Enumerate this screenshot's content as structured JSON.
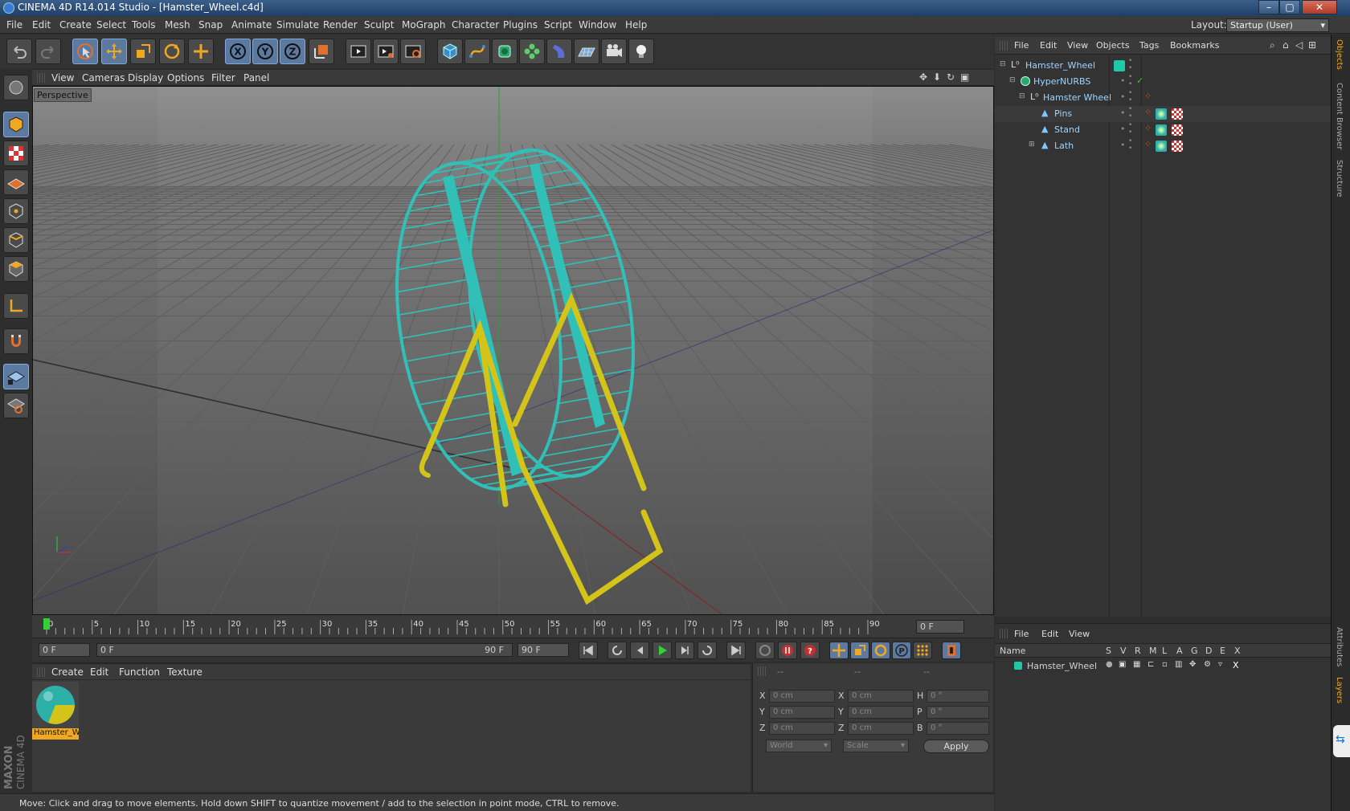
{
  "window": {
    "title": "CINEMA 4D R14.014 Studio - [Hamster_Wheel.c4d]",
    "min": "–",
    "max": "▢",
    "close": "✕"
  },
  "menubar": {
    "items": [
      "File",
      "Edit",
      "Create",
      "Select",
      "Tools",
      "Mesh",
      "Snap",
      "Animate",
      "Simulate",
      "Render",
      "Sculpt",
      "MoGraph",
      "Character",
      "Plugins",
      "Script",
      "Window",
      "Help"
    ],
    "layout_label": "Layout:",
    "layout_value": "Startup (User)"
  },
  "toolbar": {
    "icons": [
      "undo-icon",
      "redo-icon",
      "live-select-icon",
      "move-icon",
      "scale-icon",
      "rotate-icon",
      "add-icon",
      "x-axis-icon",
      "y-axis-icon",
      "z-axis-icon",
      "coordinate-system-icon",
      "render-view-icon",
      "render-picture-viewer-icon",
      "edit-render-settings-icon",
      "cube-icon",
      "spline-icon",
      "nurbs-icon",
      "mograph-cloner-icon",
      "deformer-icon",
      "scene-floor-icon",
      "camera-icon",
      "light-icon"
    ],
    "axes": [
      "X",
      "Y",
      "Z"
    ]
  },
  "viewport": {
    "menu": [
      "View",
      "Cameras",
      "Display",
      "Options",
      "Filter",
      "Panel"
    ],
    "label": "Perspective",
    "colors": {
      "wheel": "#30c0b8",
      "stand": "#d4c41a",
      "bg_top": "#8a8a8a",
      "bg_bottom": "#4b4b4b"
    }
  },
  "timeline": {
    "ticks": [
      "0",
      "5",
      "10",
      "15",
      "20",
      "25",
      "30",
      "35",
      "40",
      "45",
      "50",
      "55",
      "60",
      "65",
      "70",
      "75",
      "80",
      "85",
      "90"
    ],
    "current_frame": "0 F",
    "start_frame": "0 F",
    "slider_left": "0 F",
    "slider_right": "90 F",
    "end_frame": "90 F",
    "playhead_frame": 0
  },
  "material_panel": {
    "menu": [
      "Create",
      "Edit",
      "Function",
      "Texture"
    ],
    "material_name": "Hamster_W"
  },
  "coordinates": {
    "headers": [
      "--",
      "--",
      "--"
    ],
    "rows": [
      {
        "axis": "X",
        "pos": "0 cm",
        "axis2": "X",
        "size": "0 cm",
        "rot_label": "H",
        "rot": "0 °"
      },
      {
        "axis": "Y",
        "pos": "0 cm",
        "axis2": "Y",
        "size": "0 cm",
        "rot_label": "P",
        "rot": "0 °"
      },
      {
        "axis": "Z",
        "pos": "0 cm",
        "axis2": "Z",
        "size": "0 cm",
        "rot_label": "B",
        "rot": "0 °"
      }
    ],
    "mode1": "World",
    "mode2": "Scale",
    "apply": "Apply"
  },
  "status": "Move: Click and drag to move elements. Hold down SHIFT to quantize movement / add to the selection in point mode, CTRL to remove.",
  "objects": {
    "menu": [
      "File",
      "Edit",
      "View",
      "Objects",
      "Tags",
      "Bookmarks"
    ],
    "items": [
      {
        "name": "Hamster_Wheel",
        "indent": 0,
        "icon": "null-icon"
      },
      {
        "name": "HyperNURBS",
        "indent": 1,
        "icon": "hypernurbs-icon"
      },
      {
        "name": "Hamster Wheel",
        "indent": 2,
        "icon": "null-icon"
      },
      {
        "name": "Pins",
        "indent": 3,
        "icon": "polygon-icon"
      },
      {
        "name": "Stand",
        "indent": 3,
        "icon": "polygon-icon"
      },
      {
        "name": "Lath",
        "indent": 3,
        "icon": "polygon-icon"
      }
    ]
  },
  "layers": {
    "menu": [
      "File",
      "Edit",
      "View"
    ],
    "columns": [
      "Name",
      "S",
      "V",
      "R",
      "M",
      "L",
      "A",
      "G",
      "D",
      "E",
      "X"
    ],
    "rows": [
      {
        "name": "Hamster_Wheel",
        "color": "#1fc8a8"
      }
    ]
  },
  "right_tabs": [
    "Objects",
    "Content Browser",
    "Structure",
    "Attributes",
    "Layers"
  ],
  "brand": {
    "maxon": "MAXON",
    "cinema": "CINEMA 4D"
  }
}
